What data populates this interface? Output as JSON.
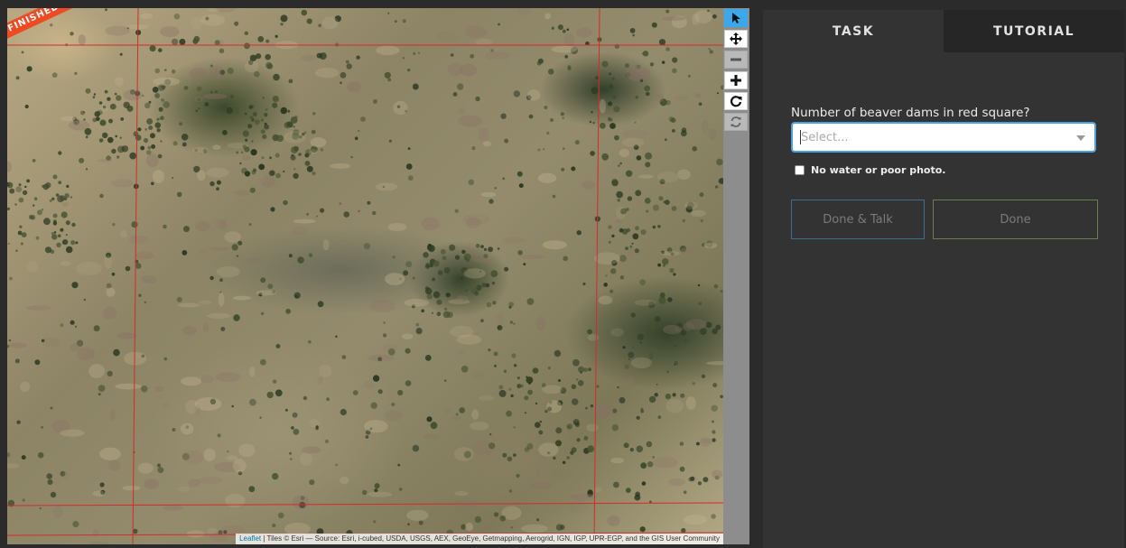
{
  "map": {
    "ribbon_label": "FINISHED!",
    "attribution_link": "Leaflet",
    "attribution_text": " | Tiles © Esri — Source: Esri, i-cubed, USDA, USGS, AEX, GeoEye, Getmapping, Aerogrid, IGN, IGP, UPR-EGP, and the GIS User Community",
    "grid_color": "#d62b2b"
  },
  "toolbar": {
    "tools": [
      {
        "icon": "cursor-icon",
        "state": "active"
      },
      {
        "icon": "move-icon",
        "state": "enabled"
      },
      {
        "icon": "zoom-out-icon",
        "state": "disabled"
      },
      {
        "icon": "zoom-in-icon",
        "state": "enabled"
      },
      {
        "icon": "rotate-icon",
        "state": "enabled"
      },
      {
        "icon": "reset-icon",
        "state": "disabled"
      }
    ]
  },
  "tabs": {
    "task": "TASK",
    "tutorial": "TUTORIAL"
  },
  "task": {
    "question": "Number of beaver dams in red square?",
    "select_placeholder": "Select...",
    "checkbox_label": "No water or poor photo.",
    "done_talk_label": "Done & Talk",
    "done_label": "Done"
  },
  "colors": {
    "accent_blue": "#3aa9ec",
    "ribbon": "#ef4b23"
  }
}
